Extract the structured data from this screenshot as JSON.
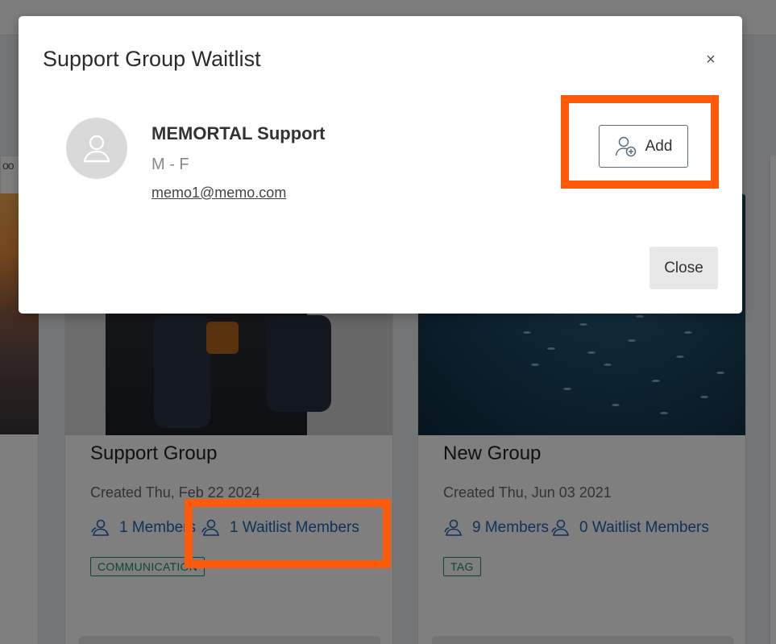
{
  "background": {
    "tile_dots": "oo",
    "cards": [
      {
        "title": "Support Group",
        "created": "Created Thu, Feb 22 2024",
        "members": "1 Members",
        "waitlist": "1 Waitlist Members",
        "tag": "COMMUNICATION"
      },
      {
        "title": "New Group",
        "created": "Created Thu, Jun 03 2021",
        "members": "9 Members",
        "waitlist": "0 Waitlist Members",
        "tag": "TAG"
      }
    ]
  },
  "modal": {
    "title": "Support Group Waitlist",
    "close_x": "×",
    "member": {
      "name": "MEMORTAL Support",
      "gender": "M - F",
      "email": "memo1@memo.com"
    },
    "add_label": "Add",
    "close_label": "Close"
  },
  "colors": {
    "highlight": "#ff5a0a",
    "link": "#1e63b4",
    "tag": "#1f8a70"
  },
  "icons": {
    "avatar": "user-icon",
    "add": "user-plus-icon",
    "members": "users-icon"
  }
}
